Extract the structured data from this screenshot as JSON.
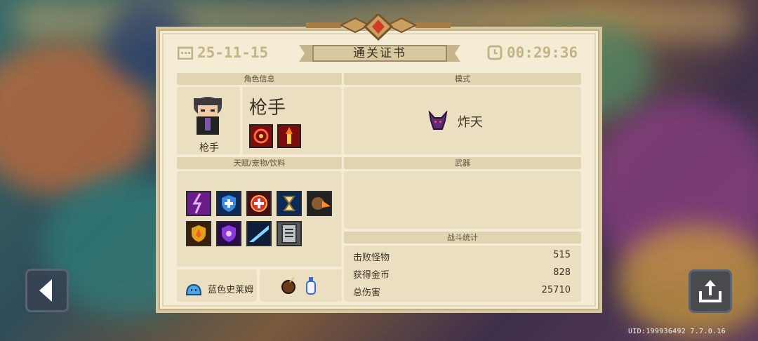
{
  "certificate": {
    "title": "通关证书",
    "date": "25-11-15",
    "time": "00:29:36"
  },
  "character": {
    "section_label": "角色信息",
    "name": "枪手",
    "portrait_label": "枪手",
    "skills": [
      "target-skill-icon",
      "flame-candle-skill-icon"
    ]
  },
  "mode": {
    "section_label": "模式",
    "name": "炸天",
    "icon": "demon-horn-icon"
  },
  "talents": {
    "section_label": "天赋/宠物/饮料",
    "icons": [
      "lightning-icon",
      "blue-shield-plus-icon",
      "red-cross-icon",
      "hourglass-icon",
      "meteor-icon",
      "flame-shield-icon",
      "purple-shield-icon",
      "energy-slash-icon",
      "document-icon"
    ],
    "pet_name": "蓝色史莱姆",
    "pet_icon": "blue-slime-icon",
    "drink_icons": [
      "coconut-drink-icon",
      "milk-bottle-icon"
    ]
  },
  "weapons": {
    "section_label": "武器"
  },
  "battle_stats": {
    "section_label": "战斗统计",
    "rows": [
      {
        "label": "击败怪物",
        "value": "515"
      },
      {
        "label": "获得金币",
        "value": "828"
      },
      {
        "label": "总伤害",
        "value": "25710"
      }
    ]
  },
  "footer": {
    "uid": "UID:199936492  7.7.0.16"
  },
  "colors": {
    "panel_bg": "#f4ecd5",
    "section_bg": "#e1d4b1",
    "box_bg": "#eadfc0",
    "header_text": "#c3b488"
  }
}
